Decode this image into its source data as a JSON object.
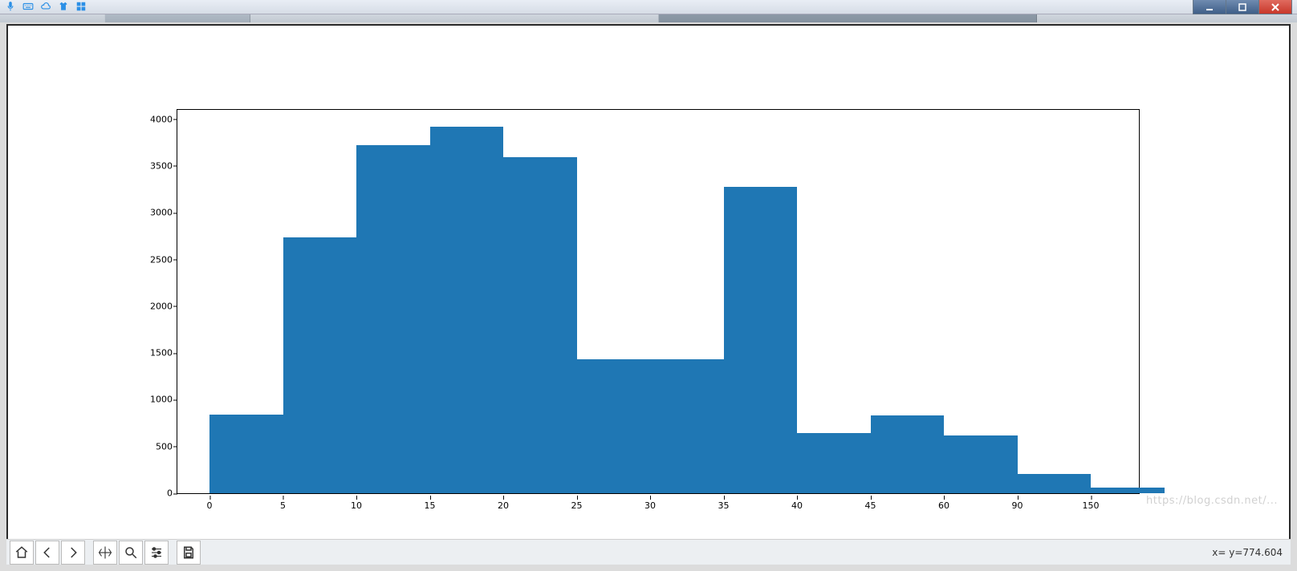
{
  "chart_data": {
    "type": "bar",
    "categories": [
      "0",
      "5",
      "10",
      "15",
      "20",
      "25",
      "30",
      "35",
      "40",
      "45",
      "60",
      "90",
      "150"
    ],
    "values": [
      840,
      2740,
      3720,
      3920,
      3590,
      1430,
      1430,
      3280,
      640,
      830,
      620,
      210,
      60
    ],
    "title": "",
    "xlabel": "",
    "ylabel": "",
    "y_ticks": [
      0,
      500,
      1000,
      1500,
      2000,
      2500,
      3000,
      3500,
      4000
    ],
    "ylim": [
      0,
      4100
    ],
    "grid": false
  },
  "toolbar": {
    "home": "Home",
    "back": "Back",
    "forward": "Forward",
    "pan": "Pan",
    "zoom": "Zoom",
    "subplots": "Configure subplots",
    "save": "Save"
  },
  "status": {
    "coords": "x= y=774.604"
  },
  "watermark": "https://blog.csdn.net/..."
}
